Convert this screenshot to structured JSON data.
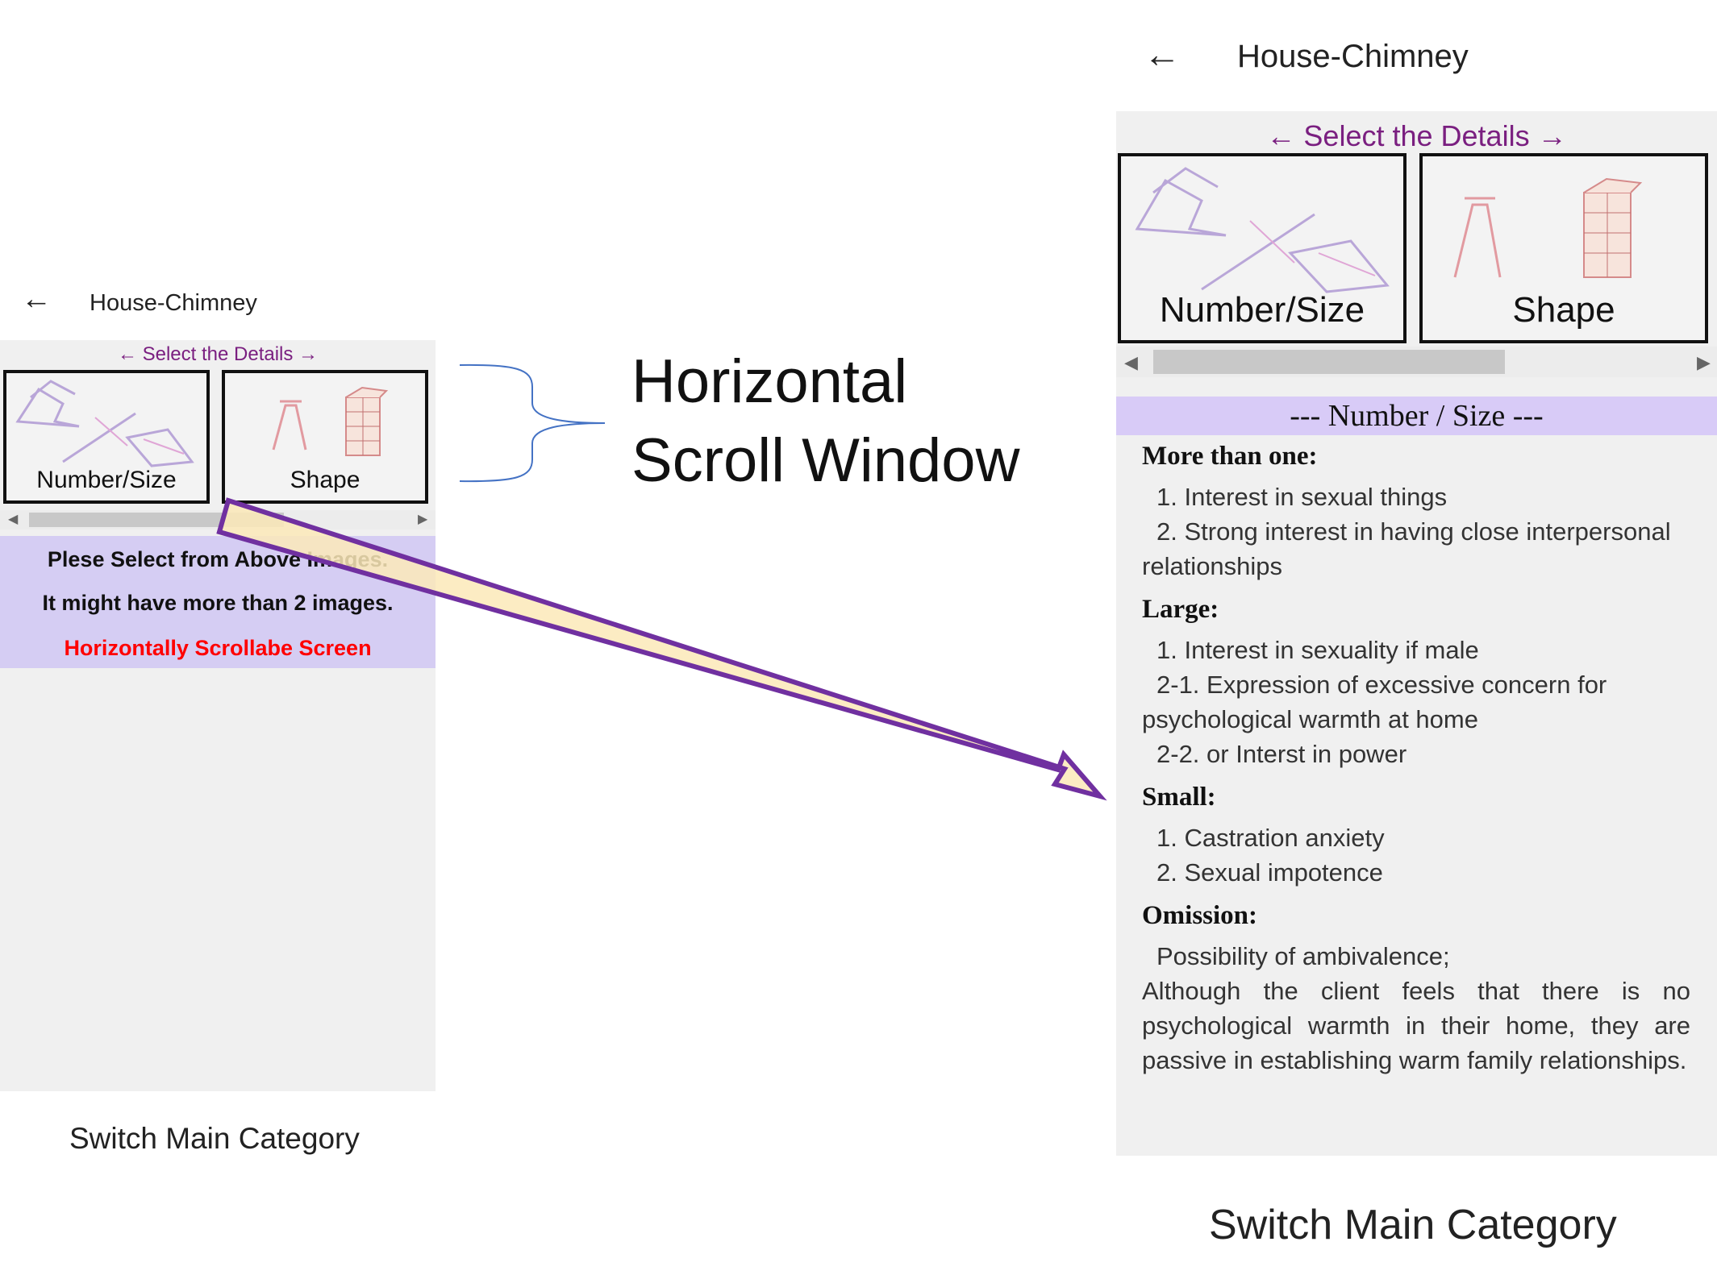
{
  "left_screen": {
    "back_icon": "arrow-left-icon",
    "title": "House-Chimney",
    "select_label": "← Select the Details →",
    "tiles": [
      {
        "label": "Number/Size",
        "icon": "number-size-sketch"
      },
      {
        "label": "Shape",
        "icon": "chimney-shape-sketch"
      }
    ],
    "message": {
      "line1": "Plese Select from Above Images.",
      "line2": "It might have more than 2 images.",
      "line3": "Horizontally Scrollabe Screen",
      "line3_color": "#ff0000"
    },
    "switch_label": "Switch Main Category"
  },
  "annotation": {
    "line1": "Horizontal",
    "line2": "Scroll Window",
    "arrow_fill": "#fce9b8",
    "arrow_stroke": "#7030a0"
  },
  "right_screen": {
    "back_icon": "arrow-left-icon",
    "title": "House-Chimney",
    "select_label": "← Select the Details →",
    "tiles": [
      {
        "label": "Number/Size",
        "icon": "number-size-sketch"
      },
      {
        "label": "Shape",
        "icon": "chimney-shape-sketch"
      }
    ],
    "section_header": "---  Number / Size  ---",
    "details": {
      "more_heading": "More than one:",
      "more_1": "1. Interest in sexual things",
      "more_2a": "2. Strong interest in having close interpersonal",
      "more_2b": "relationships",
      "large_heading": "Large:",
      "large_1": "1. Interest in sexuality if male",
      "large_2a": "2-1. Expression of excessive concern for",
      "large_2b": "psychological warmth at home",
      "large_3": "2-2. or Interst in power",
      "small_heading": "Small:",
      "small_1": "1. Castration anxiety",
      "small_2": "2. Sexual impotence",
      "omission_heading": "Omission:",
      "omission_1": "Possibility of ambivalence;",
      "omission_2": "Although the client feels that there is no psychological warmth in their home, they are passive in establishing warm family relationships."
    },
    "switch_label": "Switch Main Category"
  },
  "colors": {
    "purple_text": "#7a1f80",
    "message_bg": "#d5cdf3",
    "section_bg": "#d8cbf7",
    "content_bg": "#f0f0f0"
  }
}
